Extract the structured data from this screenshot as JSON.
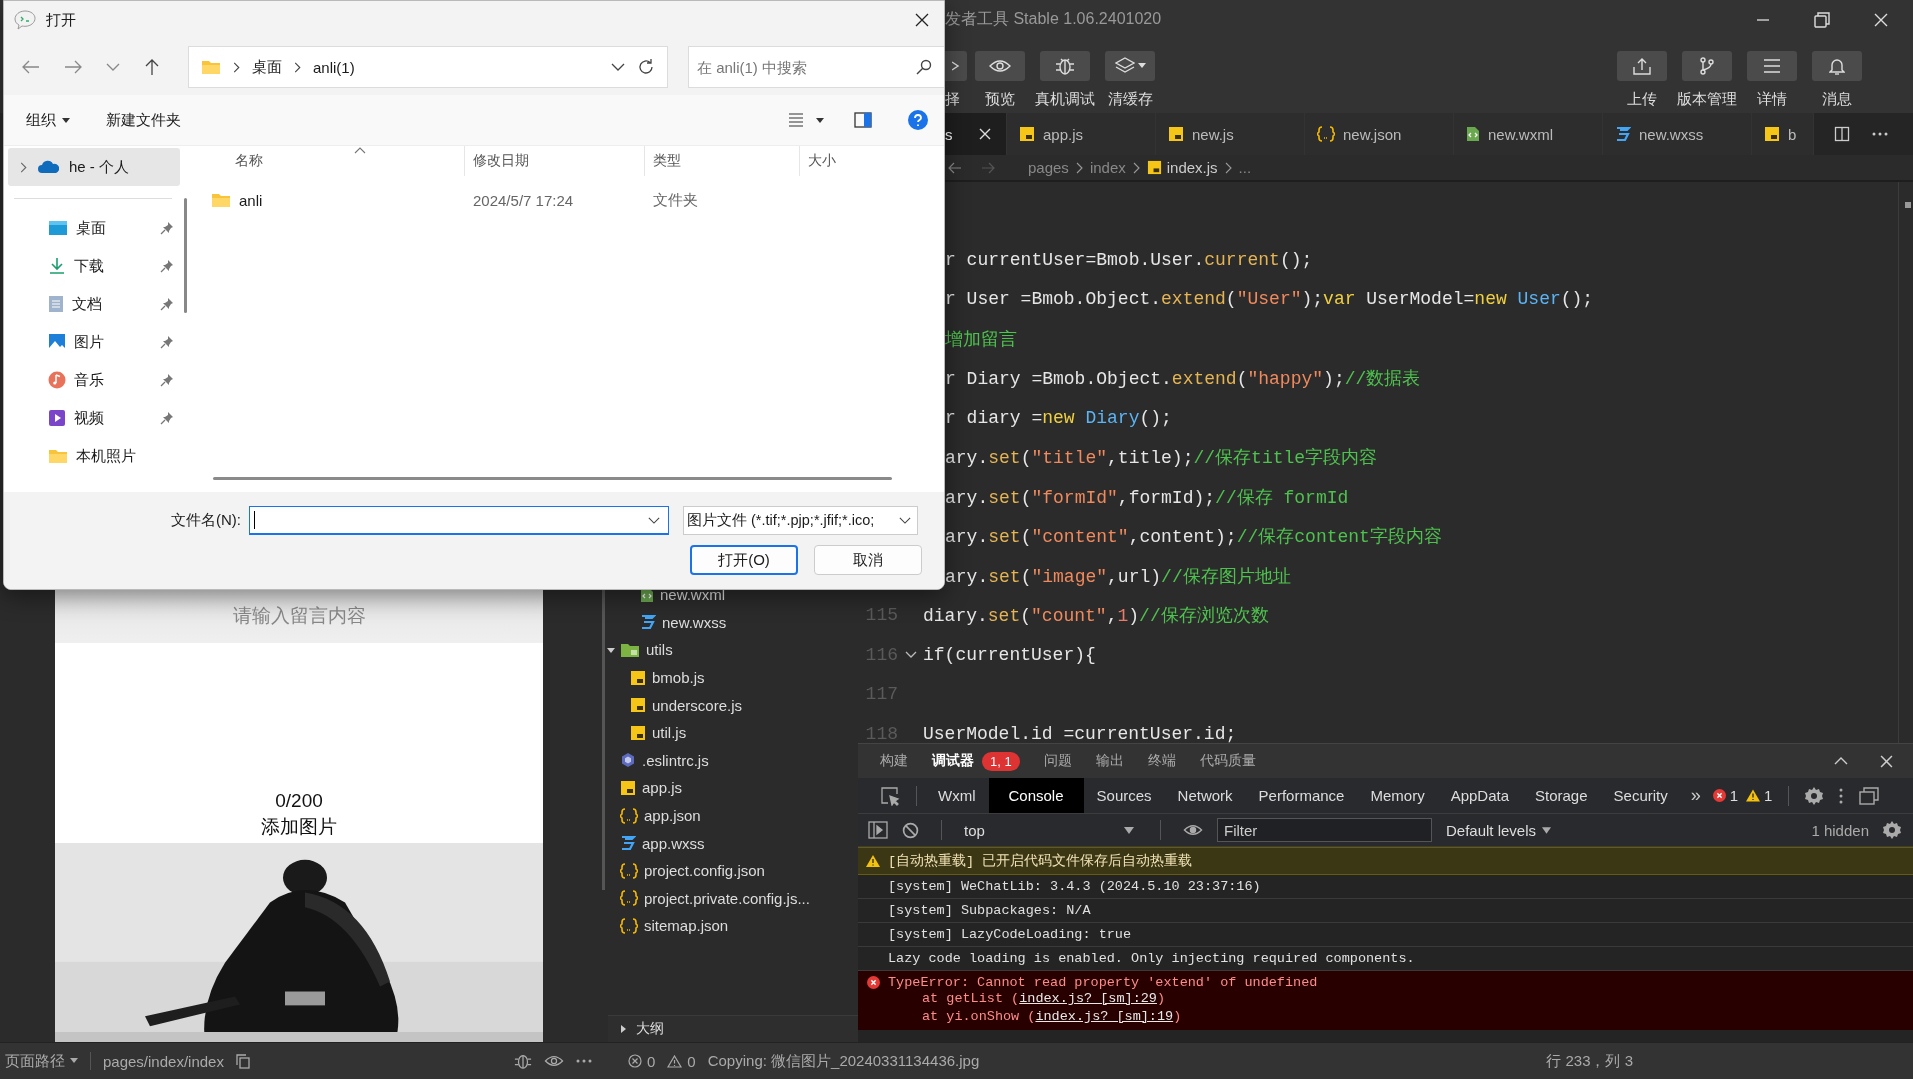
{
  "ide": {
    "title": "发者工具 Stable 1.06.2401020",
    "toolbar_left": [
      {
        "kind": "cut",
        "label": "择"
      },
      {
        "kind": "eye",
        "label": "预览"
      },
      {
        "kind": "bug",
        "label": "真机调试"
      },
      {
        "kind": "layers",
        "label": "清缓存"
      }
    ],
    "toolbar_right": [
      {
        "kind": "upload",
        "label": "上传"
      },
      {
        "kind": "branch",
        "label": "版本管理"
      },
      {
        "kind": "menu",
        "label": "详情"
      },
      {
        "kind": "bell",
        "label": "消息"
      }
    ]
  },
  "simulator": {
    "placeholder": "请输入留言内容",
    "counter": "0/200",
    "add_image": "添加图片"
  },
  "file_tree": [
    {
      "children": [
        {
          "children": [
            {
              "name": "new.wxml",
              "kind": "wxml"
            },
            {
              "name": "new.wxss",
              "kind": "wxss"
            }
          ]
        }
      ]
    },
    {
      "name": "utils",
      "kind": "folder",
      "expanded": true,
      "children": [
        {
          "name": "bmob.js",
          "kind": "js"
        },
        {
          "name": "underscore.js",
          "kind": "js"
        },
        {
          "name": "util.js",
          "kind": "js"
        }
      ]
    },
    {
      "name": ".eslintrc.js",
      "kind": "eslint"
    },
    {
      "name": "app.js",
      "kind": "js"
    },
    {
      "name": "app.json",
      "kind": "json"
    },
    {
      "name": "app.wxss",
      "kind": "wxss"
    },
    {
      "name": "project.config.json",
      "kind": "json"
    },
    {
      "name": "project.private.config.js...",
      "kind": "json"
    },
    {
      "name": "sitemap.json",
      "kind": "json"
    }
  ],
  "outline": {
    "label": "大纲",
    "expanded": false
  },
  "editor": {
    "tabs": [
      {
        "label": "s",
        "kind": "none",
        "selected": true
      },
      {
        "label": "app.js",
        "kind": "js",
        "selected": false
      },
      {
        "label": "new.js",
        "kind": "js",
        "selected": false
      },
      {
        "label": "new.json",
        "kind": "json",
        "selected": false
      },
      {
        "label": "new.wxml",
        "kind": "wxml",
        "selected": false
      },
      {
        "label": "new.wxss",
        "kind": "wxss",
        "selected": false
      },
      {
        "label": "b",
        "kind": "js",
        "selected": false
      }
    ],
    "breadcrumb": [
      {
        "label": "pages",
        "kind": "none"
      },
      {
        "label": "index",
        "kind": "none"
      },
      {
        "label": "index.js",
        "kind": "js"
      },
      {
        "label": "...",
        "kind": "none"
      }
    ],
    "code_lines": [
      {
        "tokens": [
          {
            "kind": "plain",
            "text": "r currentUser=Bmob.User."
          },
          {
            "kind": "function",
            "text": "current"
          },
          {
            "kind": "plain",
            "text": "();"
          }
        ]
      },
      {
        "tokens": [
          {
            "kind": "plain",
            "text": "r User =Bmob.Object."
          },
          {
            "kind": "function",
            "text": "extend"
          },
          {
            "kind": "plain",
            "text": "("
          },
          {
            "kind": "string",
            "text": "\"User\""
          },
          {
            "kind": "plain",
            "text": ");"
          },
          {
            "kind": "keyword",
            "text": "var"
          },
          {
            "kind": "plain",
            "text": " UserModel="
          },
          {
            "kind": "keyword",
            "text": "new"
          },
          {
            "kind": "class",
            "text": " User"
          },
          {
            "kind": "plain",
            "text": "();"
          }
        ]
      },
      {
        "tokens": [
          {
            "kind": "comment",
            "text": "增加留言"
          }
        ]
      },
      {
        "tokens": [
          {
            "kind": "plain",
            "text": "r Diary =Bmob.Object."
          },
          {
            "kind": "function",
            "text": "extend"
          },
          {
            "kind": "plain",
            "text": "("
          },
          {
            "kind": "string",
            "text": "\"happy\""
          },
          {
            "kind": "plain",
            "text": ");"
          },
          {
            "kind": "comment",
            "text": "//数据表"
          }
        ]
      },
      {
        "tokens": [
          {
            "kind": "plain",
            "text": "r diary ="
          },
          {
            "kind": "keyword",
            "text": "new"
          },
          {
            "kind": "class",
            "text": " Diary"
          },
          {
            "kind": "plain",
            "text": "();"
          }
        ]
      },
      {
        "tokens": [
          {
            "kind": "plain",
            "text": "ary."
          },
          {
            "kind": "function",
            "text": "set"
          },
          {
            "kind": "plain",
            "text": "("
          },
          {
            "kind": "string",
            "text": "\"title\""
          },
          {
            "kind": "plain",
            "text": ",title);"
          },
          {
            "kind": "comment",
            "text": "//保存title字段内容"
          }
        ]
      },
      {
        "tokens": [
          {
            "kind": "plain",
            "text": "ary."
          },
          {
            "kind": "function",
            "text": "set"
          },
          {
            "kind": "plain",
            "text": "("
          },
          {
            "kind": "string",
            "text": "\"formId\""
          },
          {
            "kind": "plain",
            "text": ",formId);"
          },
          {
            "kind": "comment",
            "text": "//保存 formId"
          }
        ]
      },
      {
        "tokens": [
          {
            "kind": "plain",
            "text": "ary."
          },
          {
            "kind": "function",
            "text": "set"
          },
          {
            "kind": "plain",
            "text": "("
          },
          {
            "kind": "string",
            "text": "\"content\""
          },
          {
            "kind": "plain",
            "text": ",content);"
          },
          {
            "kind": "comment",
            "text": "//保存content字段内容"
          }
        ]
      },
      {
        "tokens": [
          {
            "kind": "plain",
            "text": "ary."
          },
          {
            "kind": "function",
            "text": "set"
          },
          {
            "kind": "plain",
            "text": "("
          },
          {
            "kind": "string",
            "text": "\"image\""
          },
          {
            "kind": "plain",
            "text": ",url)"
          },
          {
            "kind": "comment",
            "text": "//保存图片地址"
          }
        ]
      },
      {
        "number": "115",
        "tokens": [
          {
            "kind": "plain",
            "text": "diary."
          },
          {
            "kind": "function",
            "text": "set"
          },
          {
            "kind": "plain",
            "text": "("
          },
          {
            "kind": "string",
            "text": "\"count\""
          },
          {
            "kind": "plain",
            "text": ","
          },
          {
            "kind": "number",
            "text": "1"
          },
          {
            "kind": "plain",
            "text": ")"
          },
          {
            "kind": "comment",
            "text": "//保存浏览次数"
          }
        ]
      },
      {
        "number": "116",
        "foldable": true,
        "tokens": [
          {
            "kind": "plain",
            "text": "if(currentUser){"
          }
        ]
      },
      {
        "number": "117"
      },
      {
        "number": "118",
        "tokens": [
          {
            "kind": "plain",
            "text": "UserModel.id =currentUser.id;"
          }
        ]
      }
    ]
  },
  "devtools": {
    "top_tabs": [
      {
        "label": "构建",
        "selected": false
      },
      {
        "label": "调试器",
        "selected": true,
        "badge": "1, 1"
      },
      {
        "label": "问题",
        "selected": false
      },
      {
        "label": "输出",
        "selected": false
      },
      {
        "label": "终端",
        "selected": false
      },
      {
        "label": "代码质量",
        "selected": false
      }
    ],
    "panel_tabs": [
      {
        "label": "Wxml",
        "selected": false
      },
      {
        "label": "Console",
        "selected": true
      },
      {
        "label": "Sources",
        "selected": false
      },
      {
        "label": "Network",
        "selected": false
      },
      {
        "label": "Performance",
        "selected": false
      },
      {
        "label": "Memory",
        "selected": false
      },
      {
        "label": "AppData",
        "selected": false
      },
      {
        "label": "Storage",
        "selected": false
      },
      {
        "label": "Security",
        "selected": false
      }
    ],
    "overflow": "»",
    "error_count": "1",
    "warning_count": "1",
    "context": "top",
    "filter_placeholder": "Filter",
    "levels": "Default levels",
    "hidden": "1 hidden",
    "messages": [
      {
        "kind": "warning",
        "text": "[自动热重载] 已开启代码文件保存后自动热重载"
      },
      {
        "kind": "info",
        "text": "[system] WeChatLib: 3.4.3 (2024.5.10 23:37:16)"
      },
      {
        "kind": "info",
        "text": "[system] Subpackages: N/A"
      },
      {
        "kind": "info",
        "text": "[system] LazyCodeLoading: true"
      },
      {
        "kind": "info",
        "text": "Lazy code loading is enabled. Only injecting required components."
      },
      {
        "kind": "error",
        "text": "TypeError: Cannot read property 'extend' of undefined",
        "stack": [
          {
            "prefix": "at getList (",
            "link": "index.js? [sm]:29",
            "suffix": ")"
          },
          {
            "prefix": "at yi.onShow (",
            "link": "index.js? [sm]:19",
            "suffix": ")"
          }
        ]
      }
    ]
  },
  "status_bar": {
    "path_label": "页面路径",
    "path": "pages/index/index",
    "errors": "0",
    "warnings": "0",
    "message": "Copying: 微信图片_20240331134436.jpg",
    "position": "行 233，列 3"
  },
  "dialog": {
    "title": "打开",
    "address": [
      "桌面",
      "anli(1)"
    ],
    "search_placeholder": "在 anli(1) 中搜索",
    "commands": [
      {
        "label": "组织",
        "dropdown": true
      },
      {
        "label": "新建文件夹",
        "dropdown": false
      }
    ],
    "account": {
      "label": "he - 个人",
      "selected": true
    },
    "quick_access": [
      {
        "label": "桌面",
        "kind": "desktop",
        "pinned": true
      },
      {
        "label": "下载",
        "kind": "download",
        "pinned": true
      },
      {
        "label": "文档",
        "kind": "document",
        "pinned": true
      },
      {
        "label": "图片",
        "kind": "pictures",
        "pinned": true
      },
      {
        "label": "音乐",
        "kind": "music",
        "pinned": true
      },
      {
        "label": "视频",
        "kind": "video",
        "pinned": true
      },
      {
        "label": "本机照片",
        "kind": "folder",
        "pinned": false
      }
    ],
    "columns": [
      "名称",
      "修改日期",
      "类型",
      "大小"
    ],
    "files": [
      {
        "name": "anli",
        "modified": "2024/5/7 17:24",
        "type": "文件夹"
      }
    ],
    "filename_label": "文件名(N):",
    "file_type": "图片文件 (*.tif;*.pjp;*.jfif;*.ico;",
    "buttons": [
      {
        "label": "打开(O)",
        "default": true
      },
      {
        "label": "取消",
        "default": false
      }
    ]
  }
}
